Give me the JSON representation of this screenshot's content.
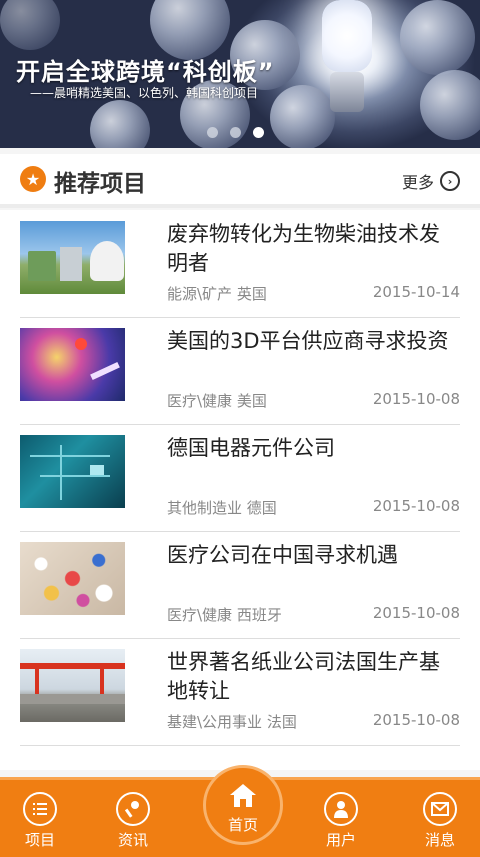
{
  "banner": {
    "title": "开启全球跨境“科创板”",
    "subtitle": "——晨哨精选美国、以色列、韩国科创项目",
    "slide_count": 3,
    "active_slide": 3
  },
  "section": {
    "title": "推荐项目",
    "more_label": "更多"
  },
  "projects": [
    {
      "title": "废弃物转化为生物柴油技术发明者",
      "category": "能源\\矿产 英国",
      "date": "2015-10-14",
      "thumb": "biogas-plant"
    },
    {
      "title": "美国的3D平台供应商寻求投资",
      "category": "医疗\\健康 美国",
      "date": "2015-10-08",
      "thumb": "medical-3d"
    },
    {
      "title": "德国电器元件公司",
      "category": "其他制造业 德国",
      "date": "2015-10-08",
      "thumb": "circuit-board"
    },
    {
      "title": "医疗公司在中国寻求机遇",
      "category": "医疗\\健康 西班牙",
      "date": "2015-10-08",
      "thumb": "pills"
    },
    {
      "title": "世界著名纸业公司法国生产基地转让",
      "category": "基建\\公用事业 法国",
      "date": "2015-10-08",
      "thumb": "construction-crane"
    }
  ],
  "nav": {
    "items": [
      {
        "label": "项目",
        "icon": "list-icon"
      },
      {
        "label": "资讯",
        "icon": "microphone-icon"
      },
      {
        "label": "首页",
        "icon": "home-icon"
      },
      {
        "label": "用户",
        "icon": "user-icon"
      },
      {
        "label": "消息",
        "icon": "mail-icon"
      }
    ]
  },
  "colors": {
    "accent": "#f07e12",
    "text": "#222222",
    "meta": "#888888"
  }
}
